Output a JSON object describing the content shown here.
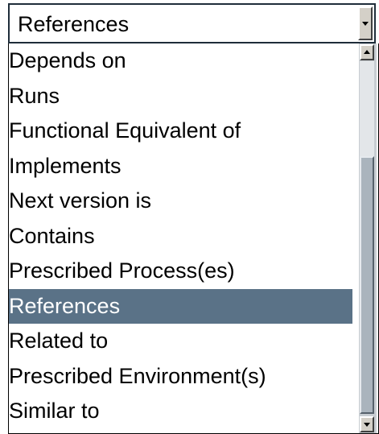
{
  "dropdown": {
    "selected_value": "References",
    "options": [
      "Depends on",
      "Runs",
      "Functional Equivalent of",
      "Implements",
      "Next version is",
      "Contains",
      "Prescribed Process(es)",
      "References",
      "Related to",
      "Prescribed Environment(s)",
      "Similar to"
    ],
    "highlighted_index": 7
  },
  "colors": {
    "highlight": "#5a7287",
    "scrollbar": "#aab4bd"
  },
  "icons": {
    "dropdown_arrow": "chevron-down-icon",
    "scroll_up": "scroll-up-arrow-icon",
    "scroll_down": "scroll-down-arrow-icon"
  }
}
